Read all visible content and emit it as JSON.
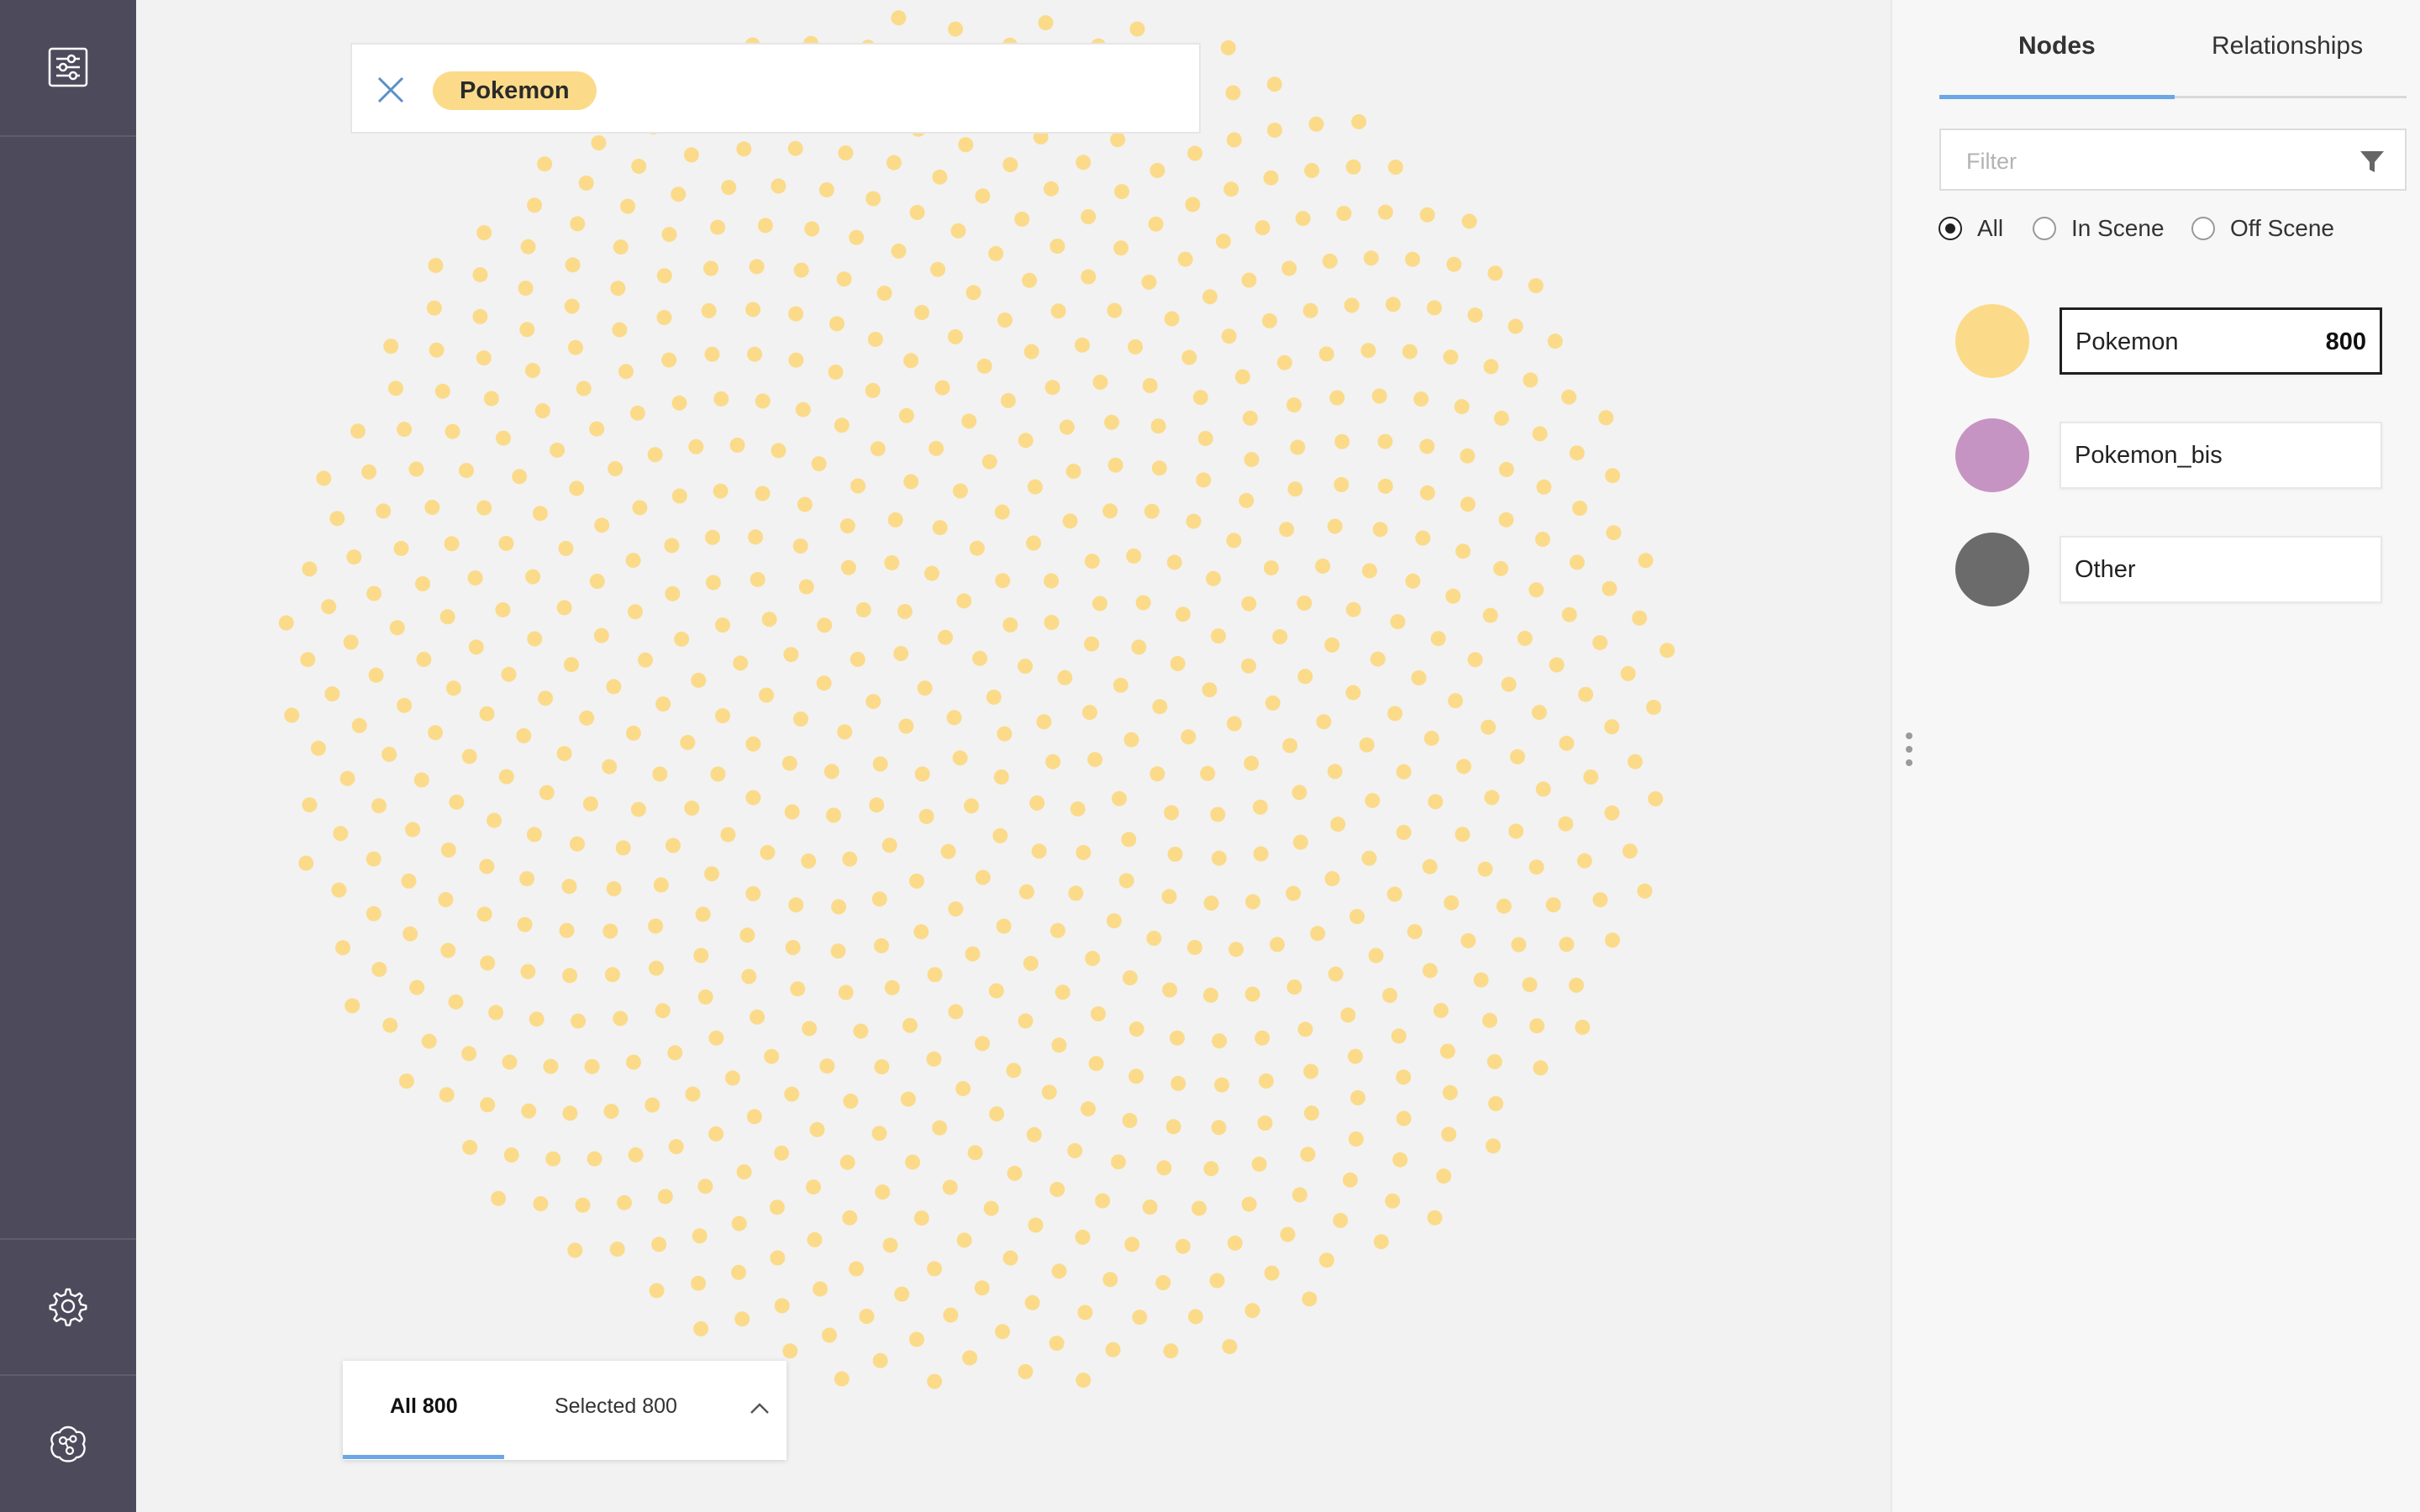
{
  "query": {
    "chip_label": "Pokemon"
  },
  "results": {
    "tab_all": "All 800",
    "tab_selected": "Selected 800"
  },
  "controls": {
    "zoom_in": "+",
    "zoom_out": "–"
  },
  "right_panel": {
    "tabs": [
      "Nodes",
      "Relationships"
    ],
    "filter_placeholder": "Filter",
    "radios": [
      {
        "label": "All",
        "checked": true
      },
      {
        "label": "In Scene",
        "checked": false
      },
      {
        "label": "Off Scene",
        "checked": false
      }
    ],
    "categories": [
      {
        "name": "Pokemon",
        "count": "800",
        "color": "#fbdb8a",
        "active": true
      },
      {
        "name": "Pokemon_bis",
        "count": "",
        "color": "#c694c3",
        "active": false
      },
      {
        "name": "Other",
        "count": "",
        "color": "#6b6b6b",
        "active": false
      }
    ]
  },
  "graph": {
    "node_count": 800,
    "node_color": "#fbdb8a"
  },
  "colors": {
    "sidebar_bg": "#4d4a5c",
    "accent": "#6aa7e6",
    "canvas_bg": "#f2f2f2"
  },
  "icons": {
    "sidebar_top": "sliders-icon",
    "sidebar_settings": "gear-icon",
    "sidebar_bottom": "brain-graph-icon",
    "query_close": "close-icon",
    "filter": "funnel-icon",
    "results_toggle": "chevron-up-icon",
    "layout": "hierarchy-icon"
  }
}
